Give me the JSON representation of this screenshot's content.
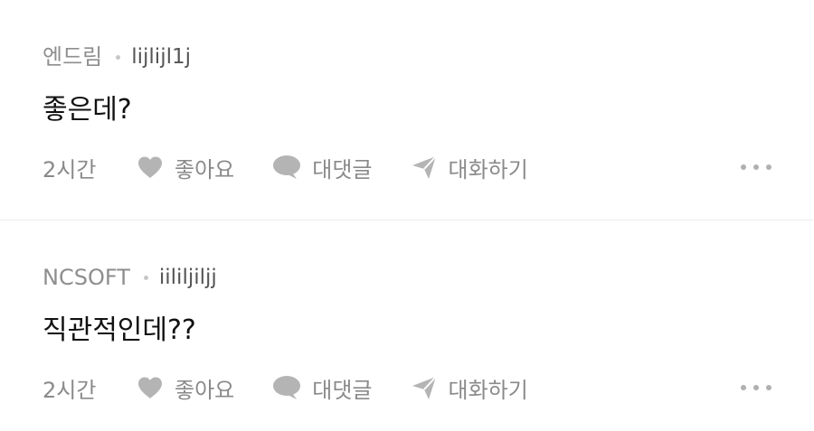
{
  "comments": [
    {
      "nickname": "엔드림",
      "handle": "lijlijl1j",
      "text": "좋은데?",
      "time": "2시간",
      "like_label": "좋아요",
      "reply_label": "대댓글",
      "chat_label": "대화하기"
    },
    {
      "nickname": "NCSOFT",
      "handle": "iililjiljj",
      "text": "직관적인데??",
      "time": "2시간",
      "like_label": "좋아요",
      "reply_label": "대댓글",
      "chat_label": "대화하기"
    }
  ],
  "icons": {
    "like": "heart-icon",
    "reply": "speech-bubble-icon",
    "chat": "paper-plane-icon",
    "more": "more-dots-icon"
  },
  "colors": {
    "icon_gray": "#b4b4b4",
    "meta_gray": "#8e8e8e",
    "divider": "#ededed"
  }
}
